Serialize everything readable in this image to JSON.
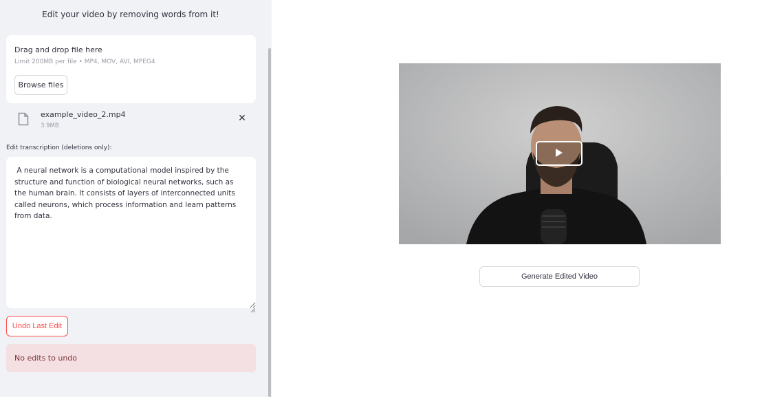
{
  "sidebar": {
    "heading": "Edit your video by removing words from it!",
    "uploader": {
      "title": "Drag and drop file here",
      "limit": "Limit 200MB per file • MP4, MOV, AVI, MPEG4",
      "browse_label": "Browse files"
    },
    "file": {
      "name": "example_video_2.mp4",
      "size": "3.9MB",
      "remove_glyph": "✕"
    },
    "transcription": {
      "label": "Edit transcription (deletions only):",
      "value": " A neural network is a computational model inspired by the structure and function of biological neural networks, such as the human brain. It consists of layers of interconnected units called neurons, which process information and learn patterns from data."
    },
    "undo_label": "Undo Last Edit",
    "alert": "No edits to undo"
  },
  "main": {
    "video": {
      "play_icon": "play-icon"
    },
    "generate_label": "Generate Edited Video"
  },
  "colors": {
    "sidebar_bg": "#f0f2f6",
    "accent_red": "#ff4b4b",
    "alert_bg": "#f4dfe2"
  }
}
